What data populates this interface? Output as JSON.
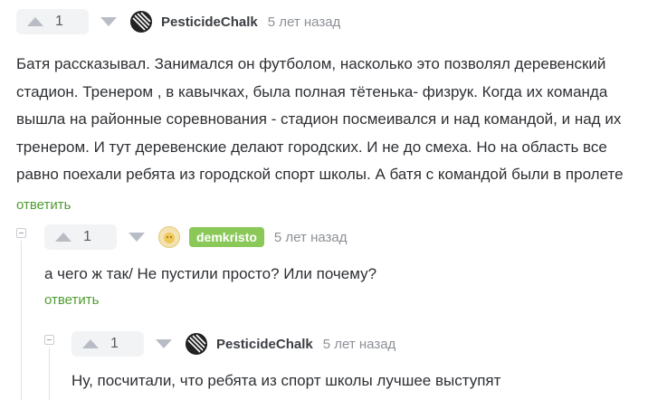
{
  "comments": [
    {
      "votes": "1",
      "author": "PesticideChalk",
      "time": "5 лет назад",
      "text": "Батя рассказывал. Занимался он футболом, насколько это позволял деревенский стадион. Тренером , в кавычках, была полная тётенька- физрук. Когда их команда вышла на районные соревнования - стадион посмеивался и над командой, и над их тренером. И тут деревенские делают городских. И не до смеха. Но на область все равно поехали ребята из городской спорт школы. А батя с командой были в пролете",
      "reply": "ответить"
    },
    {
      "votes": "1",
      "author": "demkristo",
      "time": "5 лет назад",
      "text": "а чего ж так/ Не пустили просто? Или почему?",
      "reply": "ответить"
    },
    {
      "votes": "1",
      "author": "PesticideChalk",
      "time": "5 лет назад",
      "text": "Ну, посчитали, что ребята из спорт школы лучшее выступят"
    }
  ],
  "colors": {
    "reply_link": "#4f9c30",
    "author_badge": "#8ac858",
    "vote_bg": "#f2f3f5"
  },
  "icons": {
    "upvote": "arrow-up-icon",
    "downvote": "arrow-down-icon",
    "collapse": "minus-box-icon"
  }
}
